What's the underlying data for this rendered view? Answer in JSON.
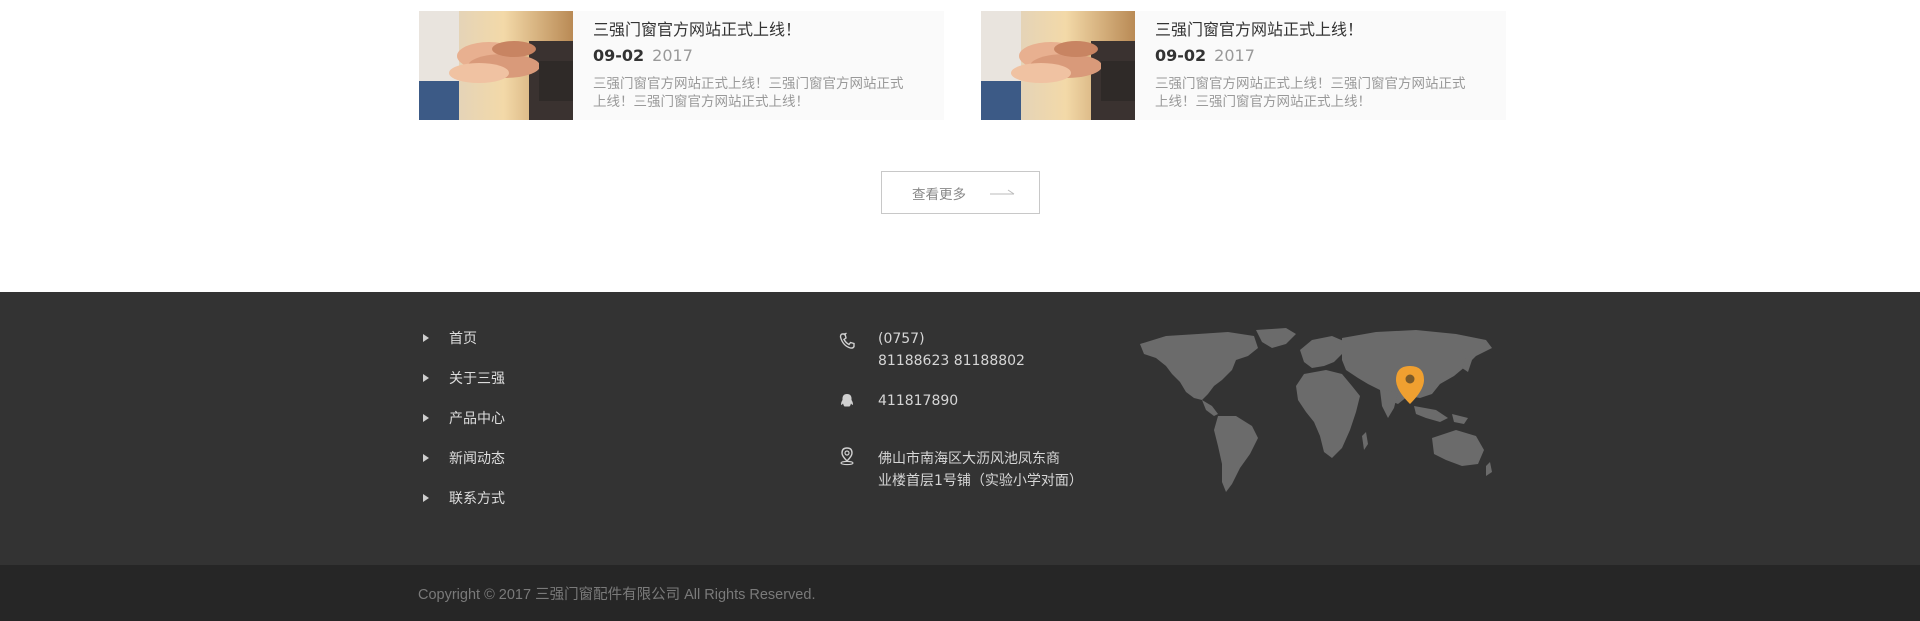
{
  "news": {
    "items": [
      {
        "title": "三强门窗官方网站正式上线！",
        "date_md": "09-02",
        "date_year": "2017",
        "desc_line1": "三强门窗官方网站正式上线！三强门窗官方网站正式",
        "desc_line2": "上线！三强门窗官方网站正式上线！"
      },
      {
        "title": "三强门窗官方网站正式上线！",
        "date_md": "09-02",
        "date_year": "2017",
        "desc_line1": "三强门窗官方网站正式上线！三强门窗官方网站正式",
        "desc_line2": "上线！三强门窗官方网站正式上线！"
      }
    ],
    "more_label": "查看更多"
  },
  "footer": {
    "nav": [
      "首页",
      "关于三强",
      "产品中心",
      "新闻动态",
      "联系方式"
    ],
    "contact": {
      "phone_area": "(0757)",
      "phone_numbers": "81188623    81188802",
      "qq": "411817890",
      "address_line1": "佛山市南海区大沥风池凤东商",
      "address_line2": "业楼首层1号铺（实验小学对面）"
    },
    "copyright": "Copyright © 2017 三强门窗配件有限公司 All Rights Reserved."
  },
  "colors": {
    "footer_bg": "#333333",
    "copyright_bg": "#262626",
    "map_land": "#6b6b6b",
    "pin": "#f0a030"
  },
  "icons": [
    "phone-icon",
    "qq-icon",
    "location-icon",
    "arrow-right-icon",
    "triangle-right-icon",
    "map-pin-icon"
  ]
}
